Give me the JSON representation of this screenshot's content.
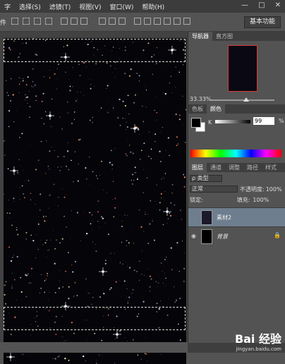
{
  "menu": {
    "items": [
      "字",
      "选择(S)",
      "滤镜(T)",
      "视图(V)",
      "窗口(W)",
      "帮助(H)"
    ],
    "window_buttons": [
      "—",
      "□",
      "✕"
    ]
  },
  "options_bar": {
    "tool_label": "件",
    "workspace": "基本功能"
  },
  "navigator": {
    "tabs": [
      "导航器",
      "直方图"
    ],
    "zoom": "33.33%"
  },
  "color_panel": {
    "tabs": [
      "色板",
      "颜色"
    ],
    "channel_label": "K",
    "value": "99",
    "unit": "%"
  },
  "layers_panel": {
    "tabs": [
      "图层",
      "通道",
      "调整",
      "路径",
      "样式"
    ],
    "filter": "类型",
    "blend_mode": "正常",
    "opacity_label": "不透明度:",
    "opacity_value": "100%",
    "lock_label": "锁定:",
    "fill_label": "填充:",
    "fill_value": "100%",
    "layers": [
      {
        "name": "素材2",
        "selected": true
      },
      {
        "name": "背景",
        "selected": false
      }
    ]
  },
  "watermark": {
    "main": "Bai 经验",
    "sub": "jingyan.baidu.com"
  },
  "colors": {
    "selected_layer": "#6e7e8e",
    "navigator_box": "#d23a3a",
    "panel_bg": "#535353"
  }
}
